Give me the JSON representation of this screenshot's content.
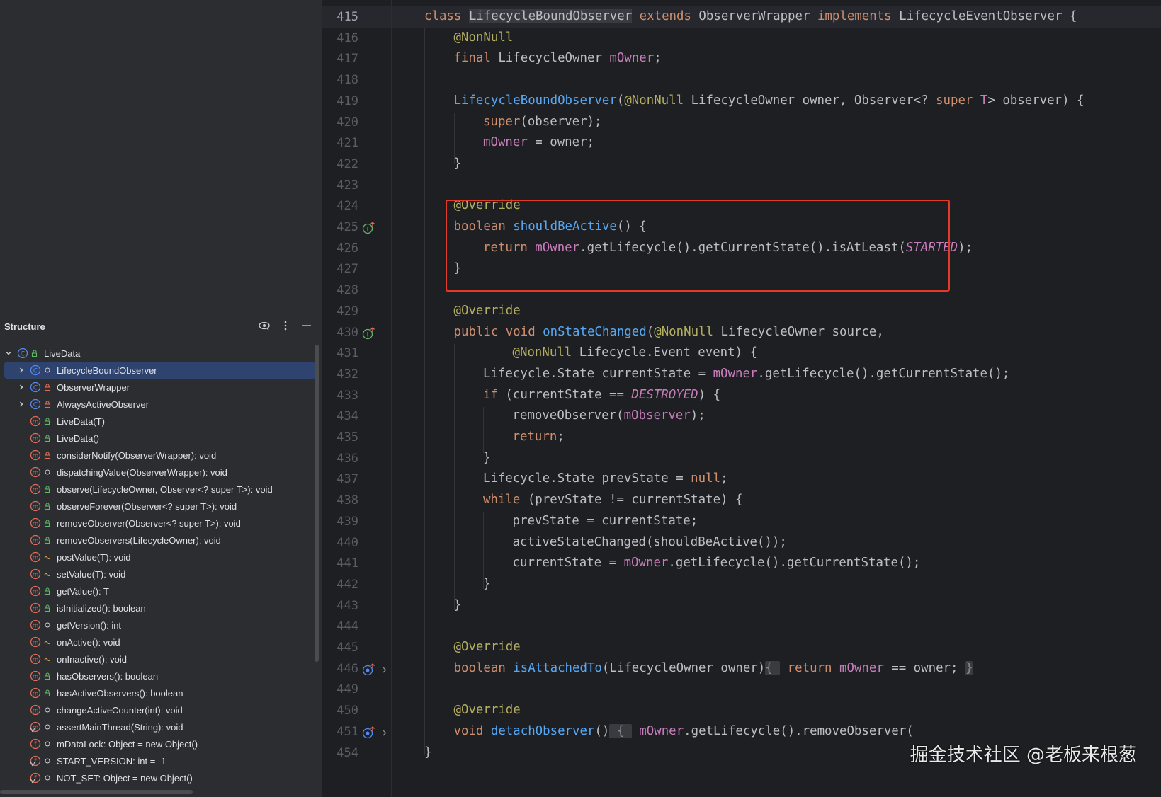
{
  "structure": {
    "title": "Structure",
    "root": {
      "label": "LiveData",
      "kind": "class",
      "visibility": "public"
    },
    "items": [
      {
        "label": "LifecycleBoundObserver",
        "kind": "class",
        "visibility": "package",
        "expandable": true,
        "selected": true
      },
      {
        "label": "ObserverWrapper",
        "kind": "class",
        "visibility": "private",
        "expandable": true
      },
      {
        "label": "AlwaysActiveObserver",
        "kind": "class",
        "visibility": "private",
        "expandable": true
      },
      {
        "label": "LiveData(T)",
        "kind": "method",
        "visibility": "public"
      },
      {
        "label": "LiveData()",
        "kind": "method",
        "visibility": "public"
      },
      {
        "label": "considerNotify(ObserverWrapper): void",
        "kind": "method",
        "visibility": "private"
      },
      {
        "label": "dispatchingValue(ObserverWrapper): void",
        "kind": "method",
        "visibility": "package"
      },
      {
        "label": "observe(LifecycleOwner, Observer<? super T>): void",
        "kind": "method",
        "visibility": "public"
      },
      {
        "label": "observeForever(Observer<? super T>): void",
        "kind": "method",
        "visibility": "public"
      },
      {
        "label": "removeObserver(Observer<? super T>): void",
        "kind": "method",
        "visibility": "public"
      },
      {
        "label": "removeObservers(LifecycleOwner): void",
        "kind": "method",
        "visibility": "public"
      },
      {
        "label": "postValue(T): void",
        "kind": "method",
        "visibility": "protected"
      },
      {
        "label": "setValue(T): void",
        "kind": "method",
        "visibility": "protected"
      },
      {
        "label": "getValue(): T",
        "kind": "method",
        "visibility": "public"
      },
      {
        "label": "isInitialized(): boolean",
        "kind": "method",
        "visibility": "public"
      },
      {
        "label": "getVersion(): int",
        "kind": "method",
        "visibility": "package"
      },
      {
        "label": "onActive(): void",
        "kind": "method",
        "visibility": "protected"
      },
      {
        "label": "onInactive(): void",
        "kind": "method",
        "visibility": "protected"
      },
      {
        "label": "hasObservers(): boolean",
        "kind": "method",
        "visibility": "public"
      },
      {
        "label": "hasActiveObservers(): boolean",
        "kind": "method",
        "visibility": "public"
      },
      {
        "label": "changeActiveCounter(int): void",
        "kind": "method",
        "visibility": "package"
      },
      {
        "label": "assertMainThread(String): void",
        "kind": "static-method",
        "visibility": "package"
      },
      {
        "label": "mDataLock: Object = new Object()",
        "kind": "field",
        "visibility": "package"
      },
      {
        "label": "START_VERSION: int = -1",
        "kind": "static-field",
        "visibility": "package"
      },
      {
        "label": "NOT_SET: Object = new Object()",
        "kind": "static-field",
        "visibility": "package"
      }
    ]
  },
  "editor": {
    "current_line": "415",
    "lines": [
      {
        "n": "415",
        "indent": 0,
        "tokens": [
          [
            "kw",
            "class "
          ],
          [
            "hl",
            "LifecycleBoundObserver"
          ],
          [
            "p",
            " "
          ],
          [
            "kw",
            "extends "
          ],
          [
            "p",
            "ObserverWrapper "
          ],
          [
            "kw",
            "implements "
          ],
          [
            "p",
            "LifecycleEventObserver {"
          ]
        ]
      },
      {
        "n": "416",
        "indent": 1,
        "tokens": [
          [
            "an",
            "@NonNull"
          ]
        ]
      },
      {
        "n": "417",
        "indent": 1,
        "tokens": [
          [
            "kw",
            "final "
          ],
          [
            "p",
            "LifecycleOwner "
          ],
          [
            "fld",
            "mOwner"
          ],
          [
            "p",
            ";"
          ]
        ]
      },
      {
        "n": "418",
        "indent": 1,
        "tokens": []
      },
      {
        "n": "419",
        "indent": 1,
        "tokens": [
          [
            "fn",
            "LifecycleBoundObserver"
          ],
          [
            "p",
            "("
          ],
          [
            "an",
            "@NonNull "
          ],
          [
            "p",
            "LifecycleOwner owner, Observer<? "
          ],
          [
            "kw",
            "super "
          ],
          [
            "fld",
            "T"
          ],
          [
            "p",
            "> observer) {"
          ]
        ]
      },
      {
        "n": "420",
        "indent": 2,
        "tokens": [
          [
            "kw",
            "super"
          ],
          [
            "p",
            "(observer);"
          ]
        ]
      },
      {
        "n": "421",
        "indent": 2,
        "tokens": [
          [
            "fld",
            "mOwner"
          ],
          [
            "p",
            " = owner;"
          ]
        ]
      },
      {
        "n": "422",
        "indent": 1,
        "tokens": [
          [
            "p",
            "}"
          ]
        ]
      },
      {
        "n": "423",
        "indent": 1,
        "tokens": []
      },
      {
        "n": "424",
        "indent": 1,
        "tokens": [
          [
            "an",
            "@Override"
          ]
        ]
      },
      {
        "n": "425",
        "indent": 1,
        "icon": "implements-up",
        "tokens": [
          [
            "kw",
            "boolean "
          ],
          [
            "fn",
            "shouldBeActive"
          ],
          [
            "p",
            "() {"
          ]
        ]
      },
      {
        "n": "426",
        "indent": 2,
        "tokens": [
          [
            "kw",
            "return "
          ],
          [
            "fld",
            "mOwner"
          ],
          [
            "p",
            ".getLifecycle().getCurrentState().isAtLeast("
          ],
          [
            "cst",
            "STARTED"
          ],
          [
            "p",
            ");"
          ]
        ]
      },
      {
        "n": "427",
        "indent": 1,
        "tokens": [
          [
            "p",
            "}"
          ]
        ]
      },
      {
        "n": "428",
        "indent": 1,
        "tokens": []
      },
      {
        "n": "429",
        "indent": 1,
        "tokens": [
          [
            "an",
            "@Override"
          ]
        ]
      },
      {
        "n": "430",
        "indent": 1,
        "icon": "implements-up",
        "tokens": [
          [
            "kw",
            "public void "
          ],
          [
            "fn",
            "onStateChanged"
          ],
          [
            "p",
            "("
          ],
          [
            "an",
            "@NonNull "
          ],
          [
            "p",
            "LifecycleOwner source,"
          ]
        ]
      },
      {
        "n": "431",
        "indent": 3,
        "tokens": [
          [
            "an",
            "@NonNull "
          ],
          [
            "p",
            "Lifecycle.Event event) {"
          ]
        ]
      },
      {
        "n": "432",
        "indent": 2,
        "tokens": [
          [
            "p",
            "Lifecycle.State currentState = "
          ],
          [
            "fld",
            "mOwner"
          ],
          [
            "p",
            ".getLifecycle().getCurrentState();"
          ]
        ]
      },
      {
        "n": "433",
        "indent": 2,
        "tokens": [
          [
            "kw",
            "if "
          ],
          [
            "p",
            "(currentState == "
          ],
          [
            "cst",
            "DESTROYED"
          ],
          [
            "p",
            ") {"
          ]
        ]
      },
      {
        "n": "434",
        "indent": 3,
        "tokens": [
          [
            "p",
            "removeObserver("
          ],
          [
            "fld",
            "mObserver"
          ],
          [
            "p",
            ");"
          ]
        ]
      },
      {
        "n": "435",
        "indent": 3,
        "tokens": [
          [
            "kw",
            "return"
          ],
          [
            "p",
            ";"
          ]
        ]
      },
      {
        "n": "436",
        "indent": 2,
        "tokens": [
          [
            "p",
            "}"
          ]
        ]
      },
      {
        "n": "437",
        "indent": 2,
        "tokens": [
          [
            "p",
            "Lifecycle.State prevState = "
          ],
          [
            "kw",
            "null"
          ],
          [
            "p",
            ";"
          ]
        ]
      },
      {
        "n": "438",
        "indent": 2,
        "tokens": [
          [
            "kw",
            "while "
          ],
          [
            "p",
            "(prevState != currentState) {"
          ]
        ]
      },
      {
        "n": "439",
        "indent": 3,
        "tokens": [
          [
            "p",
            "prevState = currentState;"
          ]
        ]
      },
      {
        "n": "440",
        "indent": 3,
        "tokens": [
          [
            "p",
            "activeStateChanged(shouldBeActive());"
          ]
        ]
      },
      {
        "n": "441",
        "indent": 3,
        "tokens": [
          [
            "p",
            "currentState = "
          ],
          [
            "fld",
            "mOwner"
          ],
          [
            "p",
            ".getLifecycle().getCurrentState();"
          ]
        ]
      },
      {
        "n": "442",
        "indent": 2,
        "tokens": [
          [
            "p",
            "}"
          ]
        ]
      },
      {
        "n": "443",
        "indent": 1,
        "tokens": [
          [
            "p",
            "}"
          ]
        ]
      },
      {
        "n": "444",
        "indent": 1,
        "tokens": []
      },
      {
        "n": "445",
        "indent": 1,
        "tokens": [
          [
            "an",
            "@Override"
          ]
        ]
      },
      {
        "n": "446",
        "indent": 1,
        "icon": "overrides-up",
        "fold": true,
        "tokens": [
          [
            "kw",
            "boolean "
          ],
          [
            "fn",
            "isAttachedTo"
          ],
          [
            "p",
            "(LifecycleOwner owner)"
          ],
          [
            "fb",
            "{ "
          ],
          [
            "kw",
            " return "
          ],
          [
            "fld",
            "mOwner"
          ],
          [
            "p",
            " == owner; "
          ],
          [
            "fb",
            "}"
          ]
        ]
      },
      {
        "n": "449",
        "indent": 1,
        "tokens": []
      },
      {
        "n": "450",
        "indent": 1,
        "tokens": [
          [
            "an",
            "@Override"
          ]
        ]
      },
      {
        "n": "451",
        "indent": 1,
        "icon": "overrides-up",
        "fold": true,
        "tokens": [
          [
            "kw",
            "void "
          ],
          [
            "fn",
            "detachObserver"
          ],
          [
            "p",
            "()"
          ],
          [
            "fb",
            " { "
          ],
          [
            "fld",
            " mOwner"
          ],
          [
            "p",
            ".getLifecycle().removeObserver("
          ]
        ]
      },
      {
        "n": "454",
        "indent": 0,
        "tokens": [
          [
            "p",
            "}"
          ]
        ]
      }
    ]
  },
  "watermark": "掘金技术社区 @老板来根葱"
}
